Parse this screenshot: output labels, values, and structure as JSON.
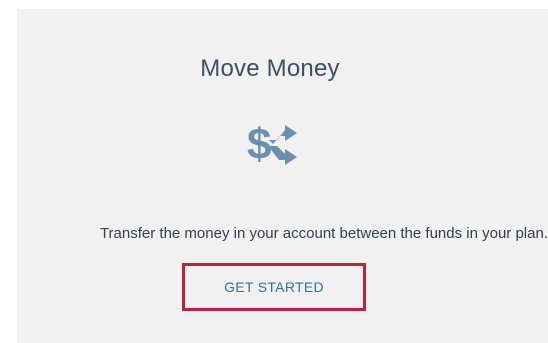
{
  "card": {
    "title": "Move Money",
    "icon": "dollar-transfer-icon",
    "description": "Transfer the money in your account between the funds in your plan.",
    "button_label": "GET STARTED"
  },
  "colors": {
    "card_background": "#f1f1f2",
    "title": "#3d4f63",
    "icon": "#6b8fae",
    "link": "#2f6fb0",
    "highlight_border": "#c0203a"
  }
}
